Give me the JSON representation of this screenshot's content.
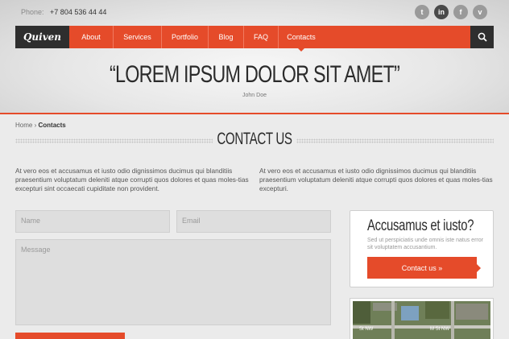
{
  "topbar": {
    "phone_label": "Phone:",
    "phone_number": "+7 804 536 44 44"
  },
  "socials": [
    {
      "icon": "twitter-icon",
      "glyph": "t"
    },
    {
      "icon": "linkedin-icon",
      "glyph": "in"
    },
    {
      "icon": "facebook-icon",
      "glyph": "f"
    },
    {
      "icon": "vimeo-icon",
      "glyph": "v"
    }
  ],
  "nav": {
    "logo": "Quiven",
    "items": [
      "About",
      "Services",
      "Portfolio",
      "Blog",
      "FAQ",
      "Contacts"
    ],
    "active": "Contacts"
  },
  "hero": {
    "quote": "“LOREM IPSUM DOLOR SIT AMET”",
    "author": "John Doe"
  },
  "breadcrumb": {
    "home": "Home",
    "separator": "›",
    "current": "Contacts"
  },
  "page": {
    "title": "CONTACT US"
  },
  "intro": {
    "left": "At vero eos et accusamus et iusto odio dignissimos ducimus qui blanditiis praesentium voluptatum deleniti atque corrupti quos dolores et quas moles-tias excepturi sint occaecati cupiditate non provident.",
    "right": "At vero eos et accusamus et iusto odio dignissimos ducimus qui blanditiis praesentium voluptatum deleniti atque corrupti quos dolores et quas moles-tias excepturi."
  },
  "form": {
    "name_placeholder": "Name",
    "email_placeholder": "Email",
    "message_placeholder": "Message"
  },
  "cta": {
    "title": "Accusamus et iusto?",
    "text": "Sed ut perspiciatis unde omnis iste natus error sit voluptatem accusantium.",
    "button": "Contact us »"
  },
  "map": {
    "street_1": "St NW",
    "street_2": "M St NW"
  },
  "colors": {
    "accent": "#e54b2a",
    "dark": "#2e2e2e"
  }
}
